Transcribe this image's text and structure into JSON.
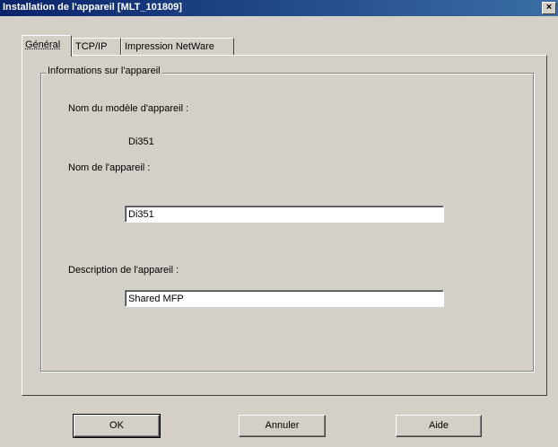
{
  "window": {
    "title": "Installation de l'appareil [MLT_101809]",
    "close_glyph": "×"
  },
  "tabs": [
    {
      "label": "Général",
      "active": true
    },
    {
      "label": "TCP/IP",
      "active": false
    },
    {
      "label": "Impression NetWare",
      "active": false
    }
  ],
  "group": {
    "title": "Informations sur l'appareil",
    "model_label": "Nom du modèle d'appareil :",
    "model_value": "Di351",
    "name_label": "Nom de l'appareil :",
    "name_value": "Di351",
    "description_label": "Description de l'appareil :",
    "description_value": "Shared MFP"
  },
  "buttons": {
    "ok": "OK",
    "cancel": "Annuler",
    "help": "Aide"
  }
}
